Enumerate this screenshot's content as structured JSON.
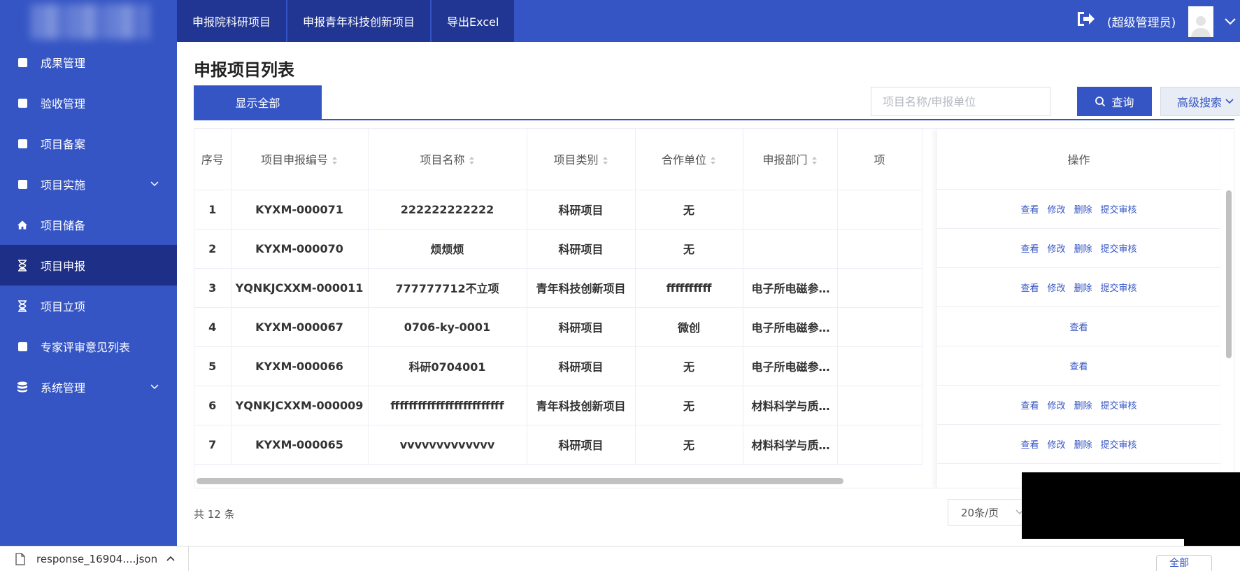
{
  "sidebar": {
    "items": [
      {
        "label": "成果管理",
        "icon": "square-icon",
        "active": false,
        "has_children": false
      },
      {
        "label": "验收管理",
        "icon": "square-icon",
        "active": false,
        "has_children": false
      },
      {
        "label": "项目备案",
        "icon": "square-icon",
        "active": false,
        "has_children": false
      },
      {
        "label": "项目实施",
        "icon": "square-icon",
        "active": false,
        "has_children": true
      },
      {
        "label": "项目储备",
        "icon": "home-icon",
        "active": false,
        "has_children": false
      },
      {
        "label": "项目申报",
        "icon": "hourglass-icon",
        "active": true,
        "has_children": false
      },
      {
        "label": "项目立项",
        "icon": "hourglass-icon",
        "active": false,
        "has_children": false
      },
      {
        "label": "专家评审意见列表",
        "icon": "square-icon",
        "active": false,
        "has_children": false
      },
      {
        "label": "系统管理",
        "icon": "database-icon",
        "active": false,
        "has_children": true
      }
    ]
  },
  "topbar": {
    "tabs": [
      "申报院科研项目",
      "申报青年科技创新项目",
      "导出Excel"
    ],
    "user": "(超级管理员)"
  },
  "page": {
    "title": "申报项目列表",
    "show_all": "显示全部",
    "search_placeholder": "项目名称/申报单位",
    "query_label": "查询",
    "advanced_label": "高级搜索"
  },
  "table": {
    "columns": [
      "序号",
      "项目申报编号",
      "项目名称",
      "项目类别",
      "合作单位",
      "申报部门",
      "项"
    ],
    "ops_header": "操作",
    "rows": [
      {
        "no": "1",
        "code": "KYXM-000071",
        "name": "222222222222",
        "type": "科研项目",
        "partner": "无",
        "dept": "",
        "ops": [
          "查看",
          "修改",
          "删除",
          "提交审核"
        ]
      },
      {
        "no": "2",
        "code": "KYXM-000070",
        "name": "烦烦烦",
        "type": "科研项目",
        "partner": "无",
        "dept": "",
        "ops": [
          "查看",
          "修改",
          "删除",
          "提交审核"
        ]
      },
      {
        "no": "3",
        "code": "YQNKJCXXM-000011",
        "name": "777777712不立项",
        "type": "青年科技创新项目",
        "partner": "ffffffffff",
        "dept": "电子所电磁参…",
        "ops": [
          "查看",
          "修改",
          "删除",
          "提交审核"
        ]
      },
      {
        "no": "4",
        "code": "KYXM-000067",
        "name": "0706-ky-0001",
        "type": "科研项目",
        "partner": "微创",
        "dept": "电子所电磁参…",
        "ops": [
          "查看"
        ]
      },
      {
        "no": "5",
        "code": "KYXM-000066",
        "name": "科研0704001",
        "type": "科研项目",
        "partner": "无",
        "dept": "电子所电磁参…",
        "ops": [
          "查看"
        ]
      },
      {
        "no": "6",
        "code": "YQNKJCXXM-000009",
        "name": "fffffffffffffffffffffffff",
        "type": "青年科技创新项目",
        "partner": "无",
        "dept": "材料科学与质…",
        "ops": [
          "查看",
          "修改",
          "删除",
          "提交审核"
        ]
      },
      {
        "no": "7",
        "code": "KYXM-000065",
        "name": "vvvvvvvvvvvvv",
        "type": "科研项目",
        "partner": "无",
        "dept": "材料科学与质…",
        "ops": [
          "查看",
          "修改",
          "删除",
          "提交审核"
        ]
      }
    ]
  },
  "footer": {
    "total": "共 12 条",
    "page_size": "20条/页"
  },
  "download_bar": {
    "file": "response_16904....json",
    "show_all": "全部"
  },
  "colors": {
    "primary": "#3555c4",
    "active_nav": "#1d2f86",
    "tab_bg": "#213592"
  }
}
